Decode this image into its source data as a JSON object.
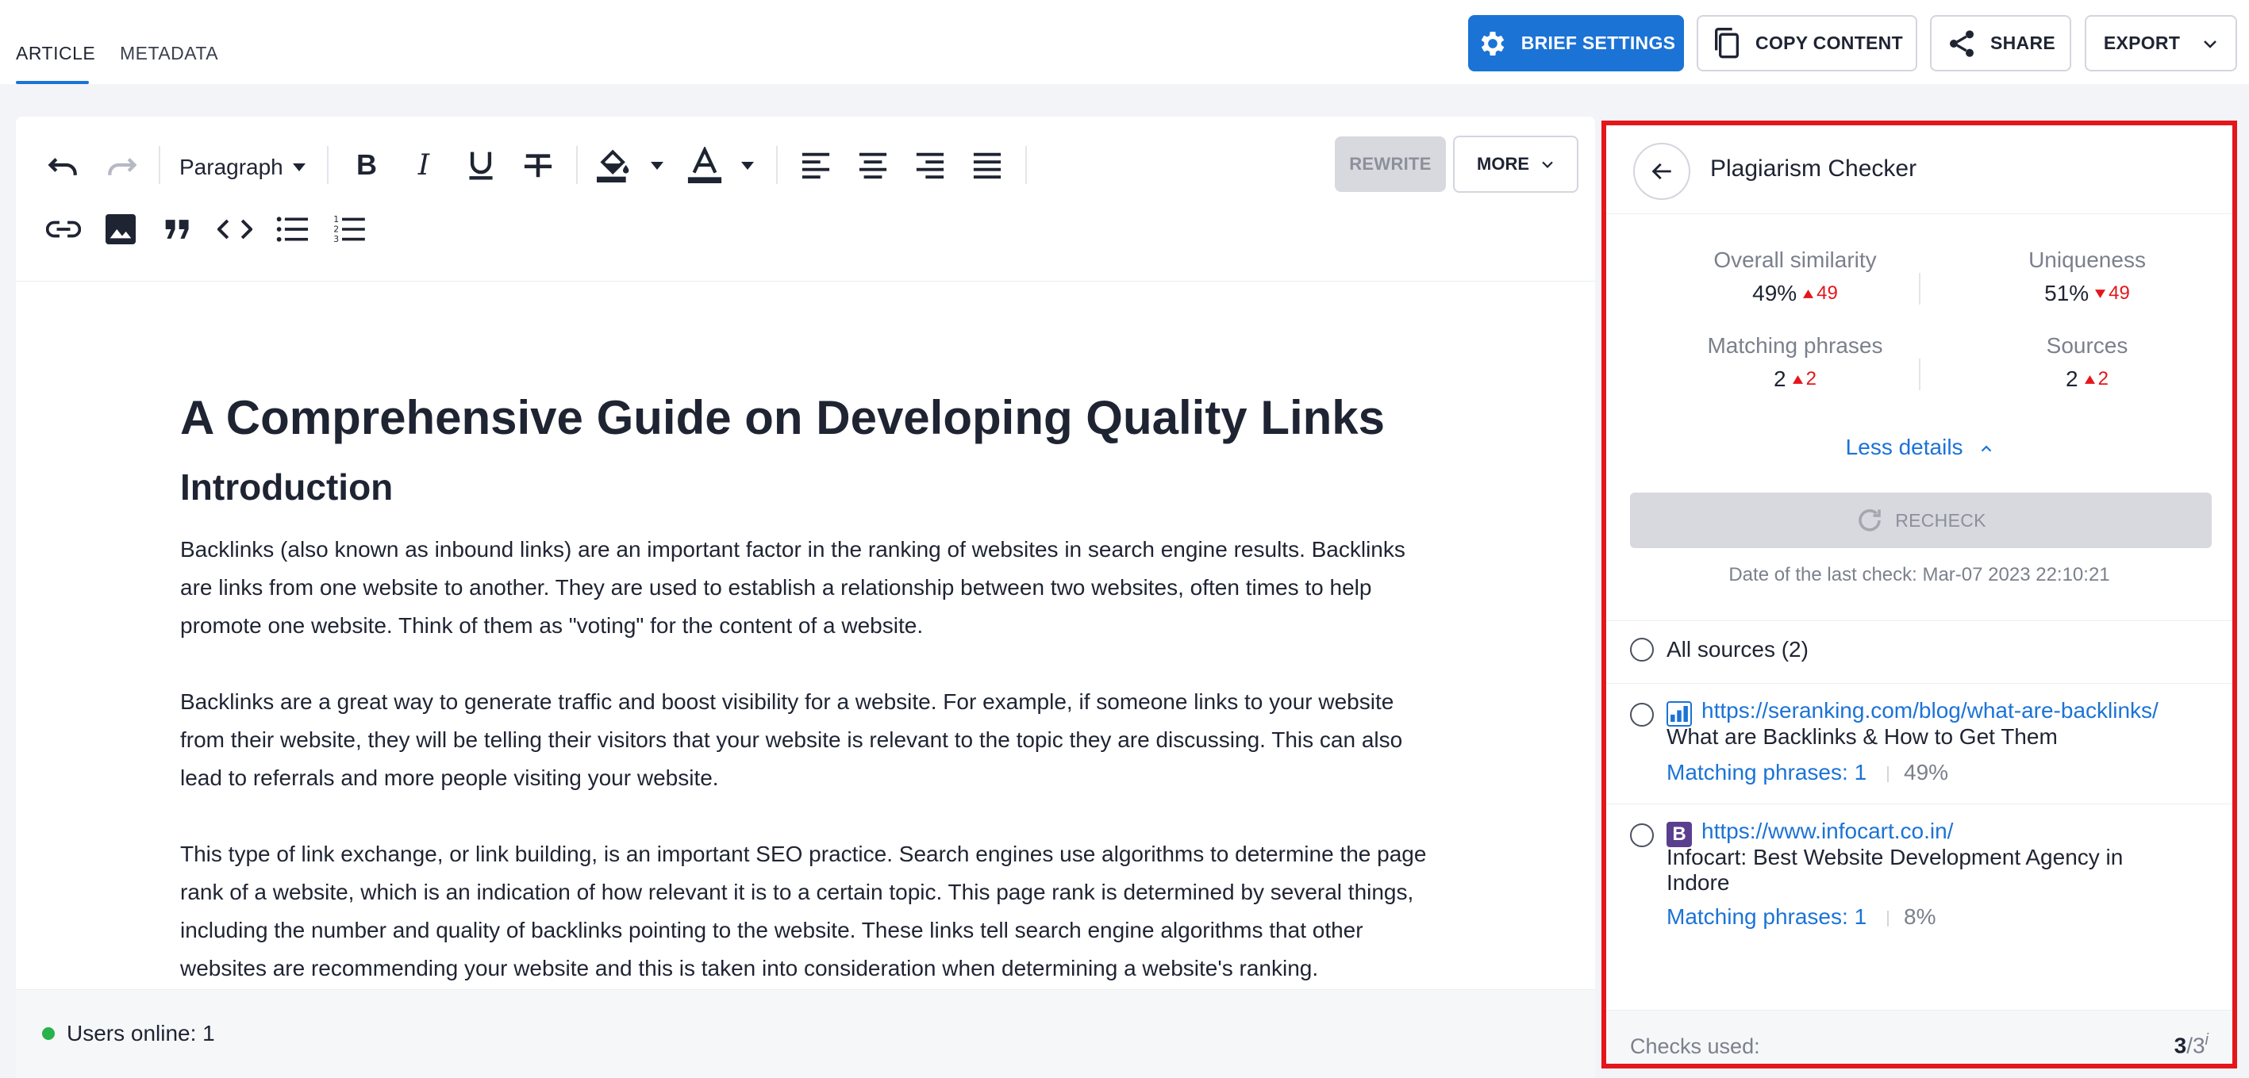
{
  "tabs": [
    {
      "label": "ARTICLE",
      "active": true
    },
    {
      "label": "METADATA",
      "active": false
    }
  ],
  "header_buttons": {
    "brief_settings": "BRIEF SETTINGS",
    "copy_content": "COPY CONTENT",
    "share": "SHARE",
    "export": "EXPORT"
  },
  "toolbar": {
    "paragraph_select": "Paragraph",
    "rewrite": "REWRITE",
    "more": "MORE",
    "icons": [
      "undo-icon",
      "redo-icon",
      "bold-icon",
      "italic-icon",
      "underline-icon",
      "strikethrough-icon",
      "highlight-color-icon",
      "text-color-icon",
      "align-left-icon",
      "align-center-icon",
      "align-right-icon",
      "align-justify-icon",
      "link-icon",
      "image-icon",
      "quote-icon",
      "code-icon",
      "bullet-list-icon",
      "numbered-list-icon"
    ]
  },
  "article": {
    "title": "A Comprehensive Guide on Developing Quality Links",
    "heading": "Introduction",
    "paragraphs": [
      "Backlinks (also known as inbound links) are an important factor in the ranking of websites in search engine results. Backlinks are links from one website to another. They are used to establish a relationship between two websites, often times to help promote one website. Think of them as \"voting\" for the content of a website.",
      "Backlinks are a great way to generate traffic and boost visibility for a website. For example, if someone links to your website from their website, they will be telling their visitors that your website is relevant to the topic they are discussing. This can also lead to referrals and more people visiting your website.",
      "This type of link exchange, or link building, is an important SEO practice. Search engines use algorithms to determine the page rank of a website, which is an indication of how relevant it is to a certain topic. This page rank is determined by several things, including the number and quality of backlinks pointing to the website. These links tell search engine algorithms that other websites are recommending your website and this is taken into consideration when determining a website's ranking."
    ]
  },
  "footer": {
    "users_online": "Users online: 1",
    "status_color": "#27b24a"
  },
  "panel": {
    "title": "Plagiarism Checker",
    "stats": {
      "overall_similarity": {
        "label": "Overall similarity",
        "value": "49%",
        "delta": "49",
        "direction": "up"
      },
      "uniqueness": {
        "label": "Uniqueness",
        "value": "51%",
        "delta": "49",
        "direction": "down"
      },
      "matching_phrases": {
        "label": "Matching phrases",
        "value": "2",
        "delta": "2",
        "direction": "up"
      },
      "sources": {
        "label": "Sources",
        "value": "2",
        "delta": "2",
        "direction": "up"
      }
    },
    "less_details": "Less details",
    "recheck": "RECHECK",
    "last_check": "Date of the last check: Mar-07 2023 22:10:21",
    "all_sources": "All sources (2)",
    "sources_list": [
      {
        "url": "https://seranking.com/blog/what-are-backlinks/",
        "title": "What are Backlinks & How to Get Them",
        "matching": "Matching phrases: 1",
        "percent": "49%",
        "favicon": "bar-chart-favicon"
      },
      {
        "url": "https://www.infocart.co.in/",
        "title": "Infocart: Best Website Development Agency in Indore",
        "matching": "Matching phrases: 1",
        "percent": "8%",
        "favicon": "letter-b-favicon",
        "favicon_letter": "B"
      }
    ],
    "checks_used_label": "Checks used:",
    "checks_used": "3",
    "checks_total": "/3",
    "checks_info": "i"
  },
  "colors": {
    "accent": "#1b73d6",
    "danger": "#e4161b",
    "highlight_border": "#e4161b"
  }
}
